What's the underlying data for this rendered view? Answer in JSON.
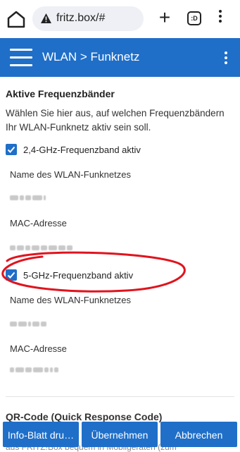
{
  "browser": {
    "url": "fritz.box/#",
    "tab_count": ":D"
  },
  "appbar": {
    "title": "WLAN > Funknetz"
  },
  "section": {
    "title": "Aktive Frequenzbänder",
    "description": "Wählen Sie hier aus, auf welchen Frequenzbändern Ihr WLAN-Funknetz aktiv sein soll."
  },
  "band24": {
    "label": "2,4-GHz-Frequenzband aktiv",
    "checked": true,
    "name_label": "Name des WLAN-Funknetzes",
    "mac_label": "MAC-Adresse"
  },
  "band5": {
    "label": "5-GHz-Frequenzband aktiv",
    "checked": true,
    "name_label": "Name des WLAN-Funknetzes",
    "mac_label": "MAC-Adresse"
  },
  "qr": {
    "title": "QR-Code (Quick Response Code)",
    "footer": "aus FRITZ!Box bequem in Mobilgeräten (zum"
  },
  "buttons": {
    "info": "Info-Blatt dru…",
    "apply": "Übernehmen",
    "cancel": "Abbrechen"
  },
  "colors": {
    "accent": "#1f6fc9",
    "annotation": "#e0141e"
  }
}
